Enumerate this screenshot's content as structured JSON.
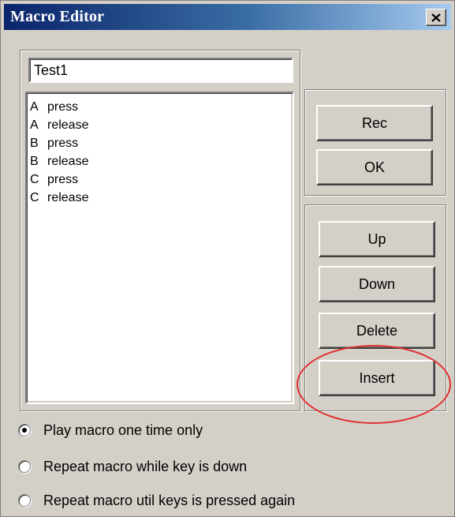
{
  "window": {
    "title": "Macro Editor"
  },
  "icons": {
    "close": "close-x-icon"
  },
  "macro": {
    "name_value": "Test1",
    "events": [
      {
        "key": "A",
        "action": "press"
      },
      {
        "key": "A",
        "action": "release"
      },
      {
        "key": "B",
        "action": "press"
      },
      {
        "key": "B",
        "action": "release"
      },
      {
        "key": "C",
        "action": "press"
      },
      {
        "key": "C",
        "action": "release"
      }
    ]
  },
  "buttons": {
    "rec": "Rec",
    "ok": "OK",
    "up": "Up",
    "down": "Down",
    "delete": "Delete",
    "insert": "Insert"
  },
  "play_mode": {
    "options": [
      {
        "label": "Play macro one time only",
        "selected": true
      },
      {
        "label": "Repeat macro while key is down",
        "selected": false
      },
      {
        "label": "Repeat macro util keys is pressed again",
        "selected": false
      }
    ]
  },
  "colors": {
    "face": "#d4d0c8",
    "title_start": "#0a246a",
    "title_end": "#a6caf0",
    "annotation": "#e03030"
  }
}
